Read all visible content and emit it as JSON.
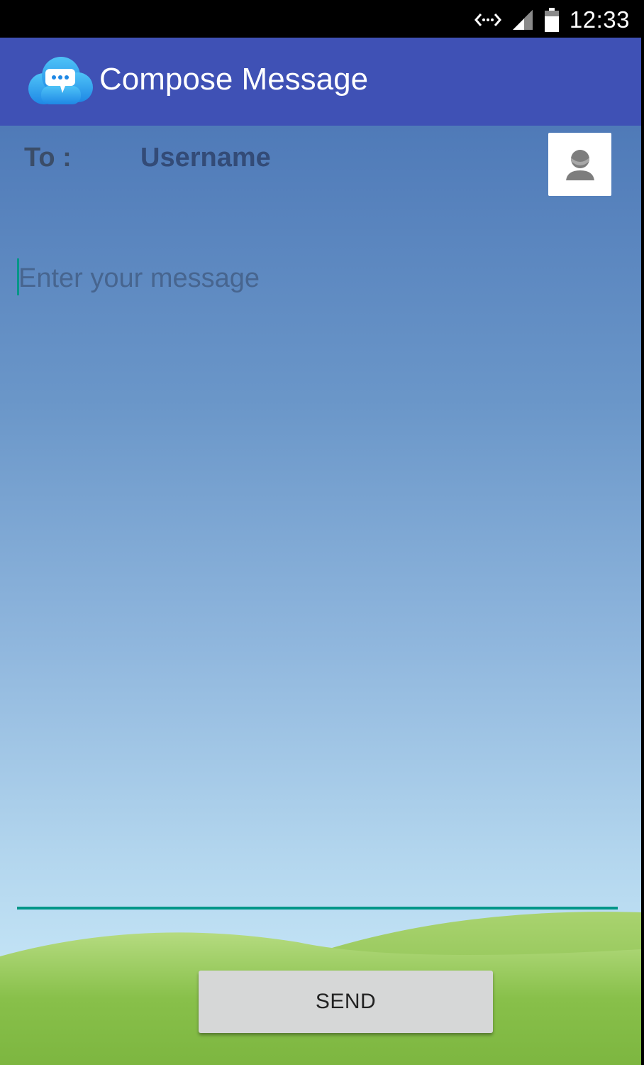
{
  "status_bar": {
    "time": "12:33",
    "icons": [
      "data-transfer-icon",
      "signal-icon",
      "battery-icon"
    ]
  },
  "app_bar": {
    "title": "Compose Message",
    "logo_icon": "chat-cloud-logo-icon",
    "color": "#3f51b5"
  },
  "compose": {
    "to_label": "To :",
    "recipient": "Username",
    "contact_icon": "contact-person-icon",
    "message_placeholder": "Enter your message",
    "accent_color": "#009688"
  },
  "actions": {
    "send_label": "SEND"
  }
}
